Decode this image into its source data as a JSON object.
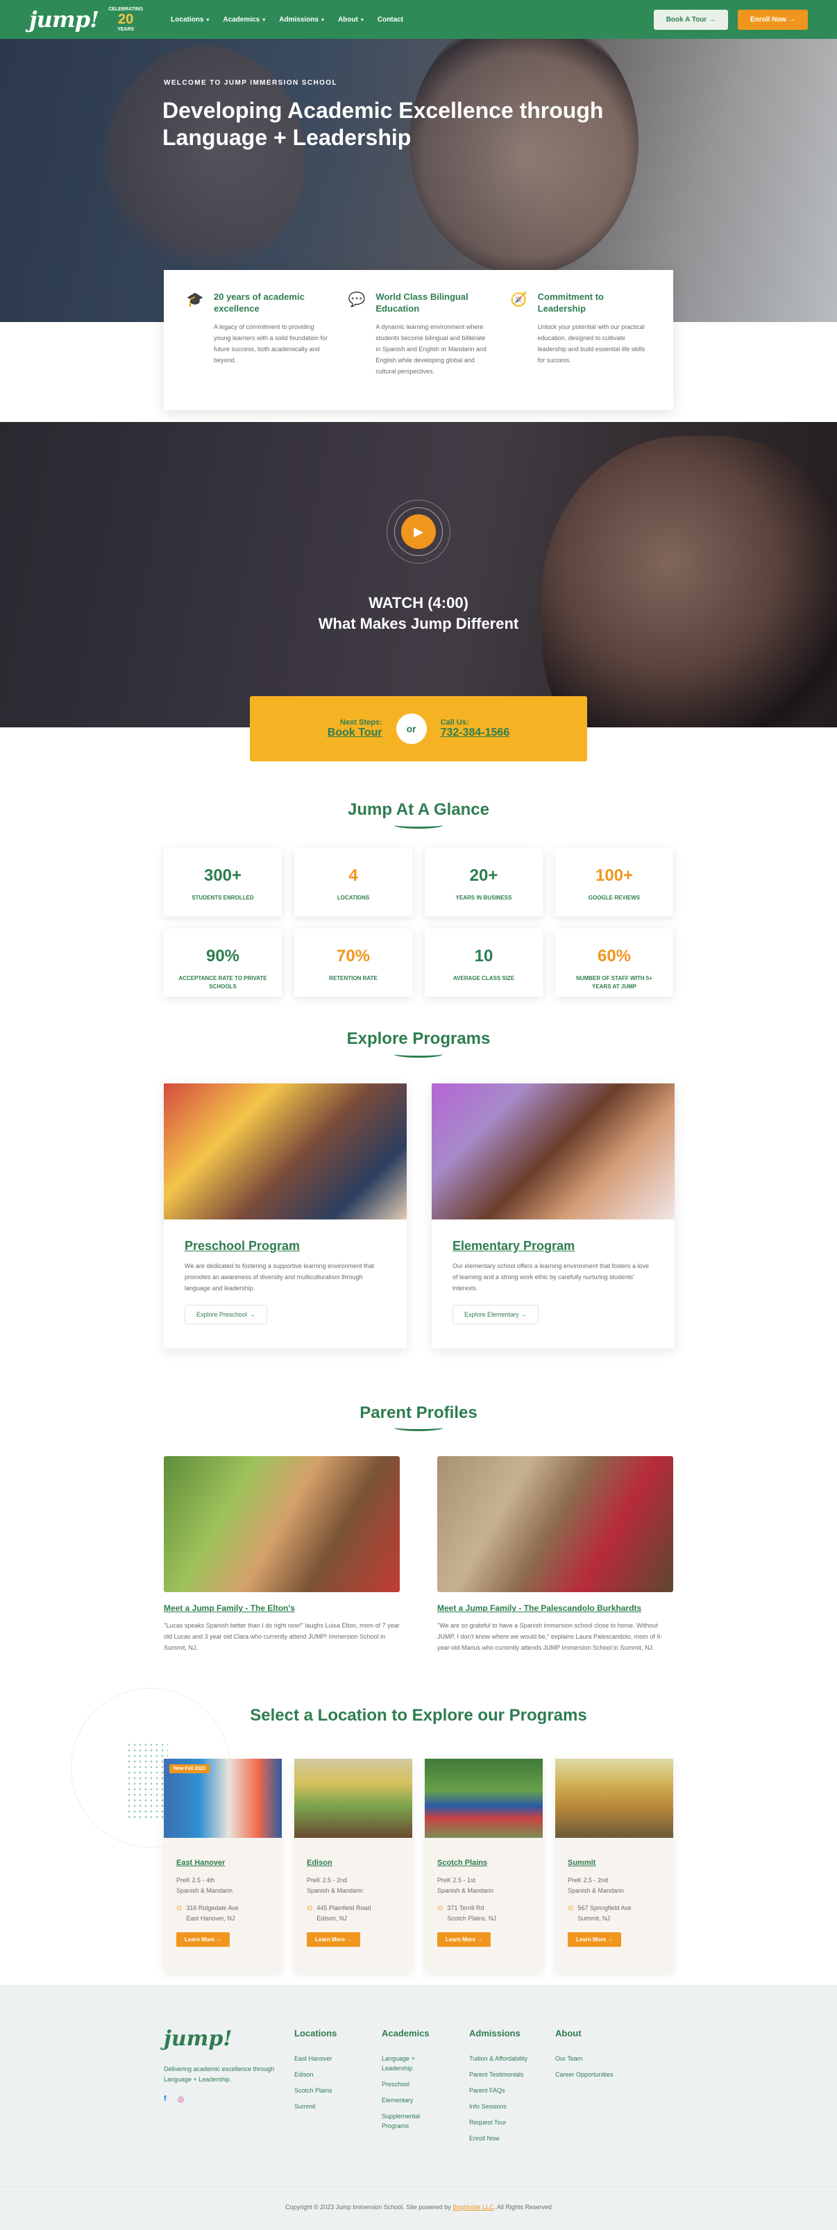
{
  "nav": {
    "logo": "jump!",
    "anniversary": {
      "top": "CELEBRATING",
      "num": "20",
      "bottom": "YEARS"
    },
    "menu": [
      {
        "label": "Locations",
        "chevron": true
      },
      {
        "label": "Academics",
        "chevron": true
      },
      {
        "label": "Admissions",
        "chevron": true
      },
      {
        "label": "About",
        "chevron": true
      },
      {
        "label": "Contact",
        "chevron": false
      }
    ],
    "book_tour": "Book A Tour",
    "enroll": "Enroll Now"
  },
  "hero": {
    "eyebrow": "WELCOME TO JUMP IMMERSION SCHOOL",
    "title": "Developing Academic Excellence through Language + Leadership"
  },
  "features": [
    {
      "icon": "graduation-cap-icon",
      "title": "20 years of academic excellence",
      "text": "A legacy of commitment to providing young learners with a solid foundation for future success, both academically and beyond."
    },
    {
      "icon": "chat-bubbles-icon",
      "title": "World Class Bilingual Education",
      "text": "A dynamic learning environment where students become bilingual and biliterate in Spanish and English or Mandarin and English while developing global and cultural perspectives."
    },
    {
      "icon": "compass-icon",
      "title": "Commitment to Leadership",
      "text": "Unlock your potential with our practical education, designed to cultivate leadership and build essential life skills for success."
    }
  ],
  "video": {
    "line1": "WATCH (4:00)",
    "line2": "What Makes Jump Different"
  },
  "next_steps": {
    "label_left": "Next Steps:",
    "link_left": "Book Tour",
    "or": "or",
    "label_right": "Call Us:",
    "link_right": "732-384-1566"
  },
  "glance": {
    "title": "Jump At A Glance",
    "stats": [
      {
        "value": "300+",
        "label": "STUDENTS ENROLLED",
        "color": "g"
      },
      {
        "value": "4",
        "label": "LOCATIONS",
        "color": "o"
      },
      {
        "value": "20+",
        "label": "YEARS IN BUSINESS",
        "color": "g"
      },
      {
        "value": "100+",
        "label": "GOOGLE REVIEWS",
        "color": "o"
      },
      {
        "value": "90%",
        "label": "ACCEPTANCE RATE TO PRIVATE SCHOOLS",
        "color": "g"
      },
      {
        "value": "70%",
        "label": "RETENTION RATE",
        "color": "o"
      },
      {
        "value": "10",
        "label": "AVERAGE CLASS SIZE",
        "color": "g"
      },
      {
        "value": "60%",
        "label": "NUMBER OF STAFF WITH 5+ YEARS AT JUMP",
        "color": "o"
      }
    ]
  },
  "programs": {
    "title": "Explore Programs",
    "items": [
      {
        "title": "Preschool Program",
        "text": "We are dedicated to fostering a supportive learning environment that promotes an awareness of diversity and multiculturalism through language and leadership.",
        "button": "Explore Preschool"
      },
      {
        "title": "Elementary Program",
        "text": "Our elementary school offers a learning environment that fosters a love of learning and a strong work ethic by carefully nurturing students' interests.",
        "button": "Explore Elementary"
      }
    ]
  },
  "parents": {
    "title": "Parent Profiles",
    "items": [
      {
        "title": "Meet a Jump Family - The Elton's",
        "text": "\"Lucas speaks Spanish better than I do right now!\" laughs Luisa Elton, mom of 7 year old Lucas and 3 year old Clara who currently attend JUMP! Immersion School in Summit, NJ."
      },
      {
        "title": "Meet a Jump Family - The Palescandolo Burkhardts",
        "text": "\"We are so grateful to have a Spanish immersion school close to home. Without JUMP, I don't know where we would be,\" explains Laura Palescandolo, mom of 6-year-old Marius who currently attends JUMP Immersion School in Summit, NJ."
      }
    ]
  },
  "locations": {
    "title": "Select a Location to Explore our Programs",
    "items": [
      {
        "tag": "New Fall 2023",
        "name": "East Hanover",
        "grades": "PreK 2.5 - 4th",
        "langs": "Spanish & Mandarin",
        "street": "316 Ridgedale Ave",
        "city": "East Hanover, NJ",
        "button": "Learn More"
      },
      {
        "tag": "",
        "name": "Edison",
        "grades": "PreK 2.5 - 2nd",
        "langs": "Spanish & Mandarin",
        "street": "445 Plainfield Road",
        "city": "Edison, NJ",
        "button": "Learn More"
      },
      {
        "tag": "",
        "name": "Scotch Plains",
        "grades": "PreK 2.5 - 1st",
        "langs": "Spanish & Mandarin",
        "street": "371 Terrill Rd",
        "city": "Scotch Plains, NJ",
        "button": "Learn More"
      },
      {
        "tag": "",
        "name": "Summit",
        "grades": "PreK 2.5 - 2nd",
        "langs": "Spanish & Mandarin",
        "street": "567 Springfield Ave",
        "city": "Summit, NJ",
        "button": "Learn More"
      }
    ]
  },
  "footer": {
    "logo": "jump!",
    "tagline": "Delivering academic excellence through Language + Leadership.",
    "social": {
      "facebook": "f",
      "instagram": "◎"
    },
    "columns": [
      {
        "title": "Locations",
        "links": [
          "East Hanover",
          "Edison",
          "Scotch Plains",
          "Summit"
        ]
      },
      {
        "title": "Academics",
        "links": [
          "Language + Leadership",
          "Preschool",
          "Elementary",
          "Supplemental Programs"
        ]
      },
      {
        "title": "Admissions",
        "links": [
          "Tuition & Affordability",
          "Parent Testimonials",
          "Parent FAQs",
          "Info Sessions",
          "Request Tour",
          "Enroll Now"
        ]
      },
      {
        "title": "About",
        "links": [
          "Our Team",
          "Career Opportunities"
        ]
      }
    ],
    "copyright": "Copyright © 2023 Jump Immersion School. Site powered by",
    "copyright_link": "Brightside LLC",
    "copyright_end": ". All Rights Reserved"
  }
}
